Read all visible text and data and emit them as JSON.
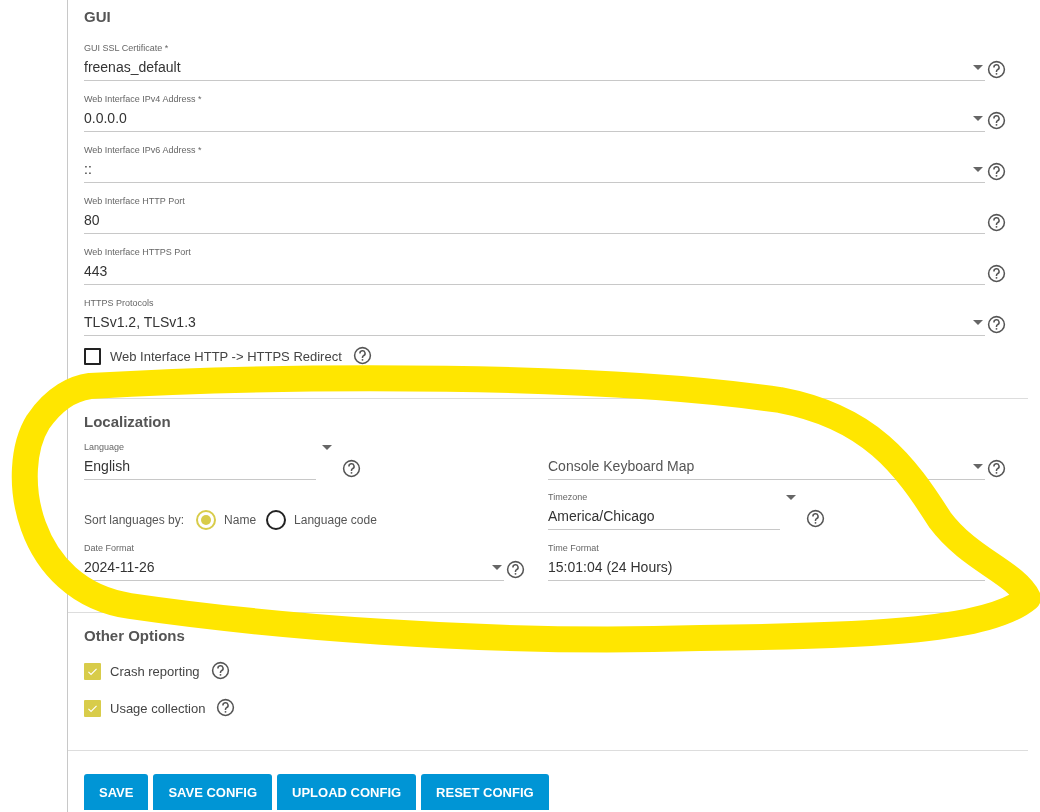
{
  "gui": {
    "title": "GUI",
    "fields": [
      {
        "kind": "select",
        "label": "GUI SSL Certificate *",
        "value": "freenas_default"
      },
      {
        "kind": "select",
        "label": "Web Interface IPv4 Address *",
        "value": "0.0.0.0"
      },
      {
        "kind": "select",
        "label": "Web Interface IPv6 Address *",
        "value": "::"
      },
      {
        "kind": "input",
        "label": "Web Interface HTTP Port",
        "value": "80"
      },
      {
        "kind": "input",
        "label": "Web Interface HTTPS Port",
        "value": "443"
      },
      {
        "kind": "select",
        "label": "HTTPS Protocols",
        "value": "TLSv1.2, TLSv1.3"
      }
    ],
    "checkbox": {
      "label": "Web Interface HTTP -> HTTPS Redirect",
      "checked": false
    }
  },
  "localization": {
    "title": "Localization",
    "columns": [
      {
        "items": [
          {
            "kind": "compact-select",
            "label": "Language",
            "value": "English"
          },
          {
            "kind": "radio-group",
            "label": "Sort languages by:",
            "options": [
              {
                "label": "Name",
                "selected": true
              },
              {
                "label": "Language code",
                "selected": false
              }
            ]
          },
          {
            "kind": "select",
            "label": "Date Format",
            "value": "2024-11-26"
          }
        ]
      },
      {
        "items": [
          {
            "kind": "select",
            "placeholder": "Console Keyboard Map"
          },
          {
            "kind": "compact-select",
            "label": "Timezone",
            "value": "America/Chicago"
          },
          {
            "kind": "select",
            "label": "Time Format",
            "value": "15:01:04 (24 Hours)"
          }
        ]
      }
    ]
  },
  "other_options": {
    "title": "Other Options",
    "checkboxes": [
      {
        "label": "Crash reporting",
        "checked": true
      },
      {
        "label": "Usage collection",
        "checked": true
      }
    ]
  },
  "buttons": [
    "SAVE",
    "SAVE CONFIG",
    "UPLOAD CONFIG",
    "RESET CONFIG"
  ],
  "annotations": [
    {
      "kind": "freehand-loop"
    }
  ]
}
